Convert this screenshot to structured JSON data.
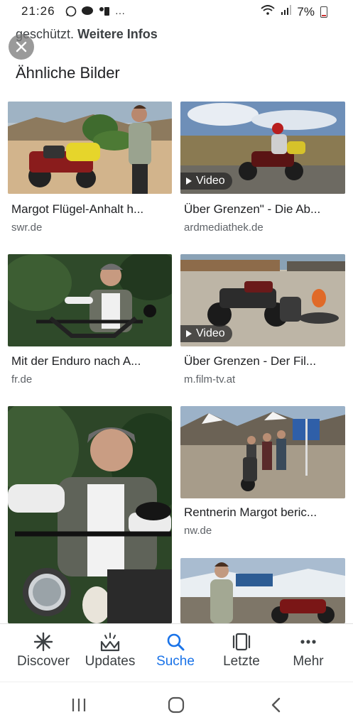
{
  "status_bar": {
    "time": "21:26",
    "battery": "7%"
  },
  "notice": {
    "text": "geschützt.",
    "link": "Weitere Infos"
  },
  "section_title": "Ähnliche Bilder",
  "video_label": "Video",
  "results": [
    {
      "caption": "Margot Flügel-Anhalt h...",
      "source": "swr.de",
      "video": false
    },
    {
      "caption": "Über Grenzen\" - Die Ab...",
      "source": "ardmediathek.de",
      "video": true
    },
    {
      "caption": "Mit der Enduro nach A...",
      "source": "fr.de",
      "video": false
    },
    {
      "caption": "Über Grenzen - Der Fil...",
      "source": "m.film-tv.at",
      "video": true
    },
    {
      "caption": "",
      "source": "",
      "video": false
    },
    {
      "caption": "Rentnerin Margot beric...",
      "source": "nw.de",
      "video": false
    },
    {
      "caption": "",
      "source": "",
      "video": false
    }
  ],
  "bottom_nav": [
    {
      "label": "Discover",
      "icon": "discover-icon",
      "active": false
    },
    {
      "label": "Updates",
      "icon": "updates-icon",
      "active": false
    },
    {
      "label": "Suche",
      "icon": "search-icon",
      "active": true
    },
    {
      "label": "Letzte",
      "icon": "recent-icon",
      "active": false
    },
    {
      "label": "Mehr",
      "icon": "more-icon",
      "active": false
    }
  ],
  "colors": {
    "accent": "#1a73e8",
    "text": "#202124",
    "secondary_text": "#5f6368"
  }
}
